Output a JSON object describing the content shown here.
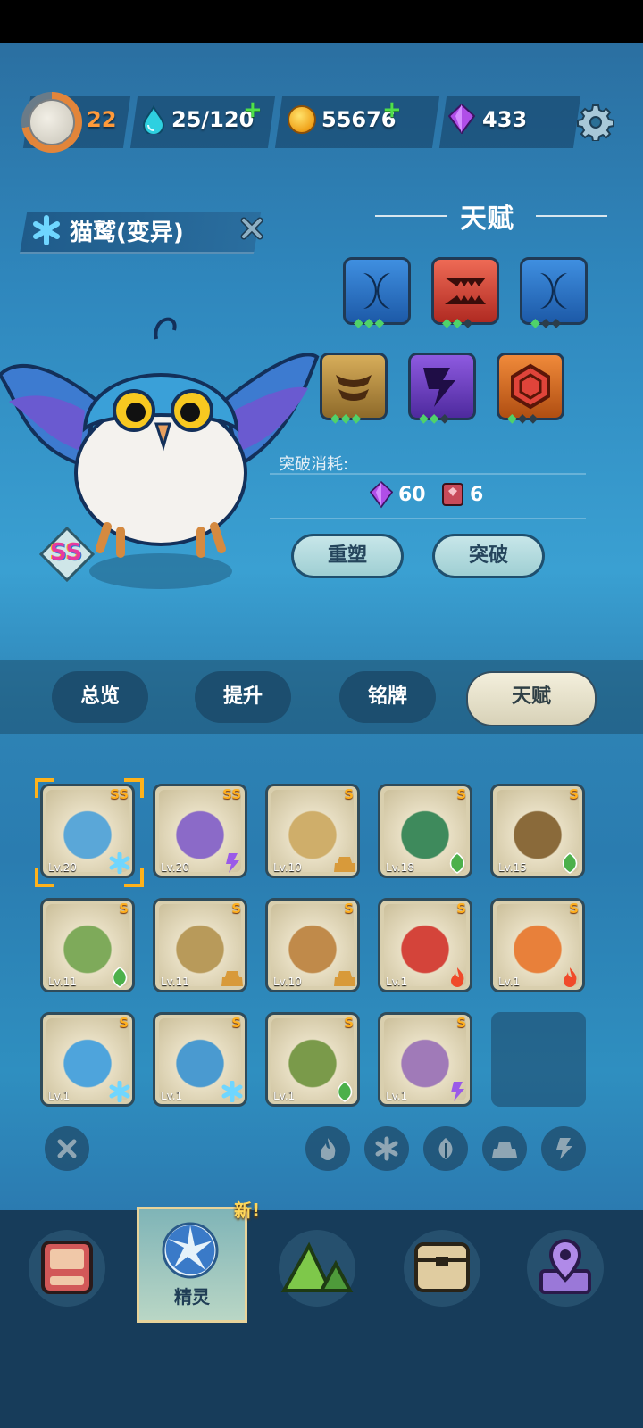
{
  "header": {
    "level": "22",
    "stamina": "25/120",
    "coins": "55676",
    "gems": "433"
  },
  "pet": {
    "name": "猫鹫(变异)",
    "rank": "SS"
  },
  "talent": {
    "title": "天赋",
    "icons": [
      {
        "name": "crescent",
        "color": "#2d74c4",
        "dots": 3
      },
      {
        "name": "fangs",
        "color": "#d24a3a",
        "dots": 2
      },
      {
        "name": "crescent",
        "color": "#2d74c4",
        "dots": 1
      },
      {
        "name": "layers",
        "color": "#b88a3a",
        "dots": 3
      },
      {
        "name": "lightning",
        "color": "#6c44b8",
        "dots": 2
      },
      {
        "name": "hexagon",
        "color": "#c9561f",
        "dots": 1
      }
    ],
    "break_label": "突破消耗:",
    "cost_gems": "60",
    "cost_books": "6",
    "reset_label": "重塑",
    "break_label_btn": "突破"
  },
  "tabs": [
    "总览",
    "提升",
    "铭牌",
    "天赋"
  ],
  "active_tab": 3,
  "pets": [
    {
      "lv": "Lv.20",
      "rank": "SS",
      "el": "ice",
      "color": "#5aa7d8",
      "selected": true
    },
    {
      "lv": "Lv.20",
      "rank": "SS",
      "el": "thunder",
      "color": "#8b6ac8"
    },
    {
      "lv": "Lv.10",
      "rank": "S",
      "el": "earth",
      "color": "#cfae6a"
    },
    {
      "lv": "Lv.18",
      "rank": "S",
      "el": "leaf",
      "color": "#3e8a5c"
    },
    {
      "lv": "Lv.15",
      "rank": "S",
      "el": "leaf",
      "color": "#8a6a3a"
    },
    {
      "lv": "Lv.11",
      "rank": "S",
      "el": "leaf",
      "color": "#7eaa5a"
    },
    {
      "lv": "Lv.11",
      "rank": "S",
      "el": "earth",
      "color": "#b89a5a"
    },
    {
      "lv": "Lv.10",
      "rank": "S",
      "el": "earth",
      "color": "#c08a4a"
    },
    {
      "lv": "Lv.1",
      "rank": "S",
      "el": "fire",
      "color": "#d4443a"
    },
    {
      "lv": "Lv.1",
      "rank": "S",
      "el": "fire",
      "color": "#e8803a"
    },
    {
      "lv": "Lv.1",
      "rank": "S",
      "el": "ice",
      "color": "#4ea4dc"
    },
    {
      "lv": "Lv.1",
      "rank": "S",
      "el": "ice",
      "color": "#4a9ad0"
    },
    {
      "lv": "Lv.1",
      "rank": "S",
      "el": "leaf",
      "color": "#7a9a4a"
    },
    {
      "lv": "Lv.1",
      "rank": "S",
      "el": "thunder",
      "color": "#a07ab8"
    }
  ],
  "nav": {
    "new_tag": "新!",
    "active_label": "精灵"
  },
  "colors": {
    "accent": "#ffb21a",
    "tab_active": "#ece6cc"
  }
}
